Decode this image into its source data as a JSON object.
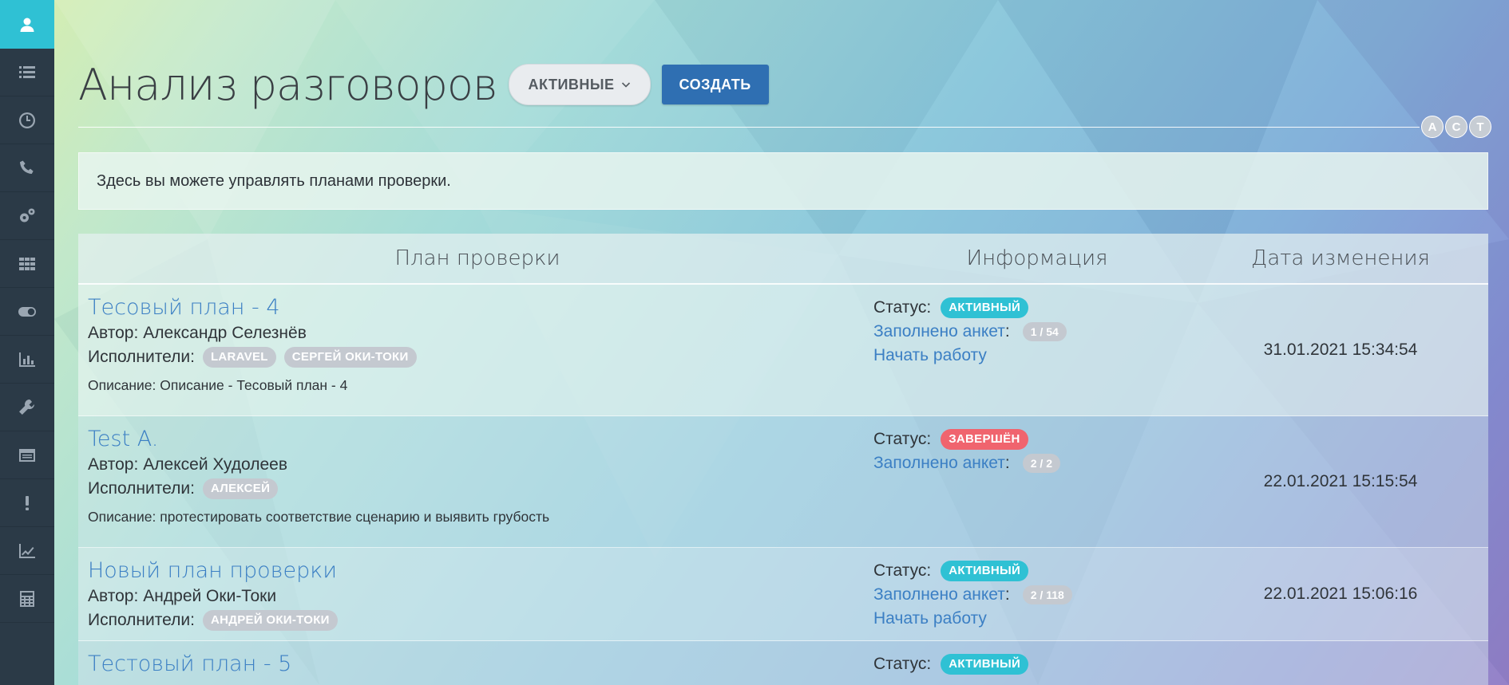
{
  "page": {
    "title": "Анализ разговоров",
    "filter_label": "АКТИВНЫЕ",
    "create_label": "СОЗДАТЬ",
    "info_text": "Здесь вы можете управлять планами проверки."
  },
  "sidebar": {
    "items": [
      {
        "icon": "user-icon"
      },
      {
        "icon": "list-icon"
      },
      {
        "icon": "clock-icon"
      },
      {
        "icon": "phone-icon"
      },
      {
        "icon": "gears-icon"
      },
      {
        "icon": "grid-icon"
      },
      {
        "icon": "toggle-icon"
      },
      {
        "icon": "bar-chart-icon"
      },
      {
        "icon": "wrench-icon"
      },
      {
        "icon": "window-icon"
      },
      {
        "icon": "exclamation-icon"
      },
      {
        "icon": "line-chart-icon"
      },
      {
        "icon": "calculator-icon"
      }
    ]
  },
  "avatars": [
    "A",
    "C",
    "T"
  ],
  "table": {
    "headers": {
      "plan": "План проверки",
      "info": "Информация",
      "date": "Дата изменения"
    },
    "labels": {
      "author": "Автор:",
      "executors": "Исполнители:",
      "description": "Описание:",
      "status": "Статус:",
      "filled": "Заполнено анкет",
      "colon": ":",
      "start_work": "Начать работу"
    },
    "rows": [
      {
        "title": "Тесовый план - 4",
        "author": "Александр Селезнёв",
        "executors": [
          "LARAVEL",
          "СЕРГЕЙ ОКИ-ТОКИ"
        ],
        "description": "Описание - Тесовый план - 4",
        "status": "АКТИВНЫЙ",
        "filled": "1 / 54",
        "date": "31.01.2021 15:34:54"
      },
      {
        "title": "Test A.",
        "author": "Алексей Худолеев",
        "executors": [
          "АЛЕКСЕЙ"
        ],
        "description": "протестировать соответствие сценарию и выявить грубость",
        "status": "ЗАВЕРШЁН",
        "filled": "2 / 2",
        "date": "22.01.2021 15:15:54"
      },
      {
        "title": "Новый план проверки",
        "author": "Андрей Оки-Токи",
        "executors": [
          "АНДРЕЙ ОКИ-ТОКИ"
        ],
        "status": "АКТИВНЫЙ",
        "filled": "2 / 118",
        "date": "22.01.2021 15:06:16"
      },
      {
        "title": "Тестовый план - 5",
        "status": "АКТИВНЫЙ"
      }
    ]
  }
}
